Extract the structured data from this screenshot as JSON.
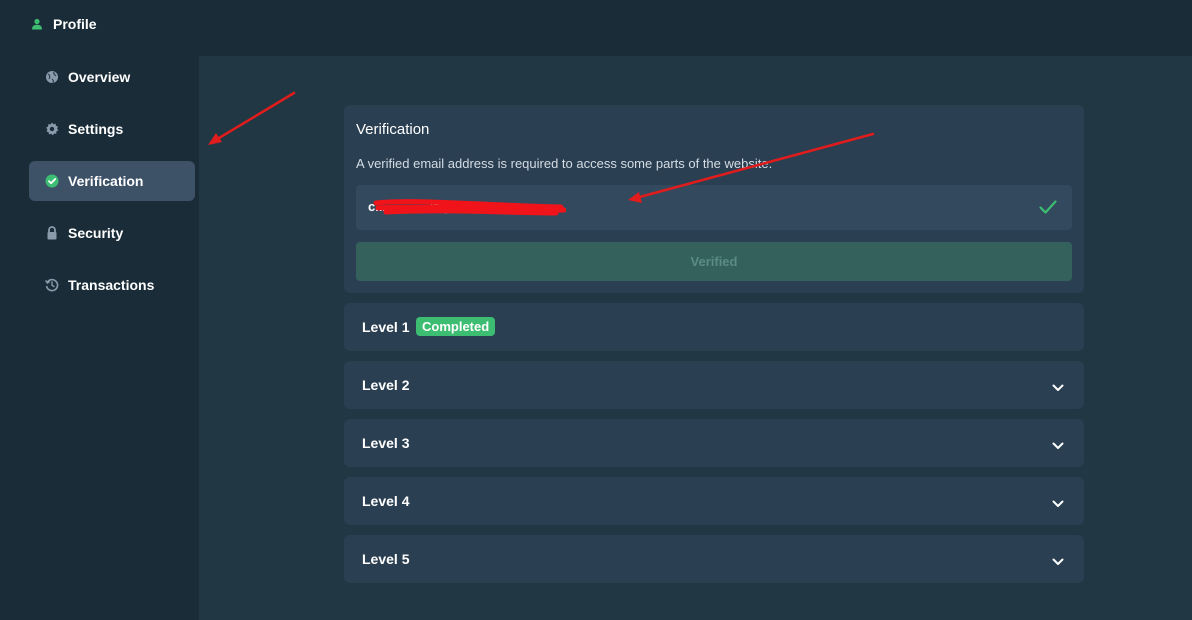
{
  "header": {
    "title": "Profile",
    "icon": "user-icon"
  },
  "sidebar": {
    "items": [
      {
        "label": "Overview",
        "icon": "globe-icon",
        "active": false
      },
      {
        "label": "Settings",
        "icon": "gear-icon",
        "active": false
      },
      {
        "label": "Verification",
        "icon": "check-circle-icon",
        "active": true
      },
      {
        "label": "Security",
        "icon": "lock-icon",
        "active": false
      },
      {
        "label": "Transactions",
        "icon": "history-icon",
        "active": false
      }
    ]
  },
  "verification": {
    "title": "Verification",
    "description": "A verified email address is required to access some parts of the website.",
    "email_value": "c...............@gmail.com",
    "button_label": "Verified"
  },
  "levels": [
    {
      "label": "Level 1",
      "badge": "Completed"
    },
    {
      "label": "Level 2"
    },
    {
      "label": "Level 3"
    },
    {
      "label": "Level 4"
    },
    {
      "label": "Level 5"
    }
  ],
  "colors": {
    "background": "#1a2c38",
    "main_panel": "#213743",
    "card": "#2a3f52",
    "active_nav": "#3d5267",
    "success": "#3cbd72",
    "annotation_red": "#e01c1c"
  }
}
